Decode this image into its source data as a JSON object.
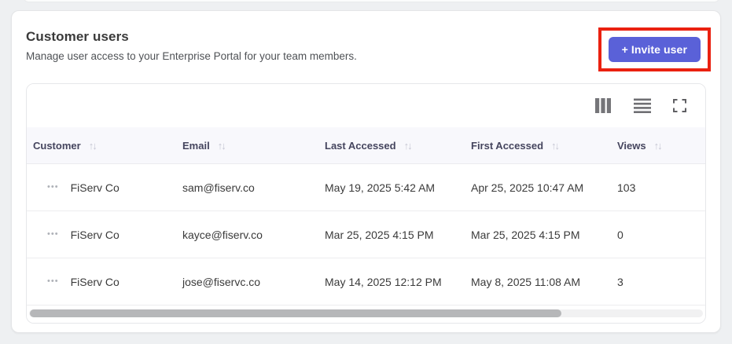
{
  "card": {
    "title": "Customer users",
    "subtitle": "Manage user access to your Enterprise Portal for your team members.",
    "invite_button_label": "+ Invite user",
    "accent_color": "#5a61d8",
    "annotation_color": "#ea2110"
  },
  "icons": {
    "sort": "↑↓",
    "row_menu": "•••"
  },
  "table": {
    "columns": [
      {
        "label": "Customer"
      },
      {
        "label": "Email"
      },
      {
        "label": "Last Accessed"
      },
      {
        "label": "First Accessed"
      },
      {
        "label": "Views"
      }
    ],
    "rows": [
      {
        "customer": "FiServ Co",
        "email": "sam@fiserv.co",
        "last_accessed": "May 19, 2025 5:42 AM",
        "first_accessed": "Apr 25, 2025 10:47 AM",
        "views": "103"
      },
      {
        "customer": "FiServ Co",
        "email": "kayce@fiserv.co",
        "last_accessed": "Mar 25, 2025 4:15 PM",
        "first_accessed": "Mar 25, 2025 4:15 PM",
        "views": "0"
      },
      {
        "customer": "FiServ Co",
        "email": "jose@fiservc.co",
        "last_accessed": "May 14, 2025 12:12 PM",
        "first_accessed": "May 8, 2025 11:08 AM",
        "views": "3"
      }
    ]
  }
}
